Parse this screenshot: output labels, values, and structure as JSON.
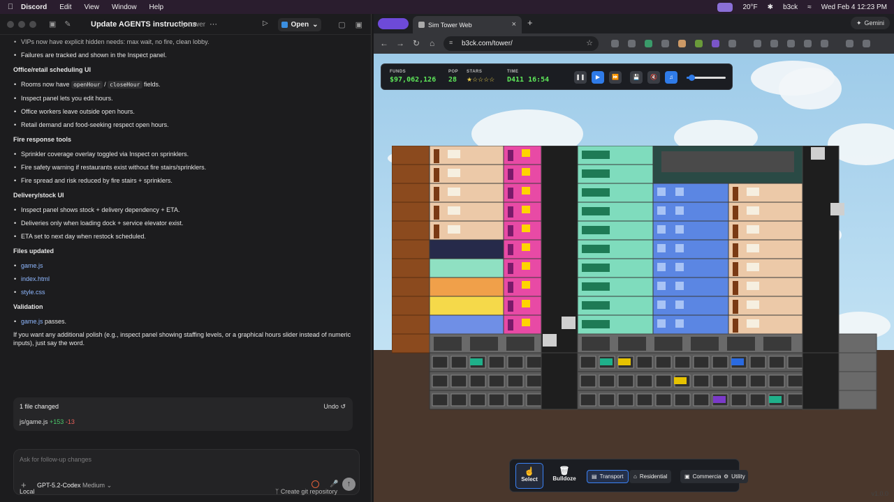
{
  "menubar": {
    "app": "Discord",
    "items": [
      "Edit",
      "View",
      "Window",
      "Help"
    ],
    "weather": "20°F",
    "user": "b3ck",
    "clock": "Wed Feb 4  12:23 PM"
  },
  "codex": {
    "title": "Update AGENTS instructions",
    "project": "my-tower",
    "open_label": "Open",
    "content": {
      "vip_line": "VIPs now have explicit hidden needs: max wait, no fire, clean lobby.",
      "failures_line": "Failures are tracked and shown in the Inspect panel.",
      "s1_title": "Office/retail scheduling UI",
      "s1_b1_pre": "Rooms now have",
      "s1_b1_code1": "openHour",
      "s1_b1_sep": "/",
      "s1_b1_code2": "closeHour",
      "s1_b1_post": "fields.",
      "s1_b2": "Inspect panel lets you edit hours.",
      "s1_b3": "Office workers leave outside open hours.",
      "s1_b4": "Retail demand and food-seeking respect open hours.",
      "s2_title": "Fire response tools",
      "s2_b1": "Sprinkler coverage overlay toggled via Inspect on sprinklers.",
      "s2_b2": "Fire safety warning if restaurants exist without fire stairs/sprinklers.",
      "s2_b3": "Fire spread and risk reduced by fire stairs + sprinklers.",
      "s3_title": "Delivery/stock UI",
      "s3_b1": "Inspect panel shows stock + delivery dependency + ETA.",
      "s3_b2": "Deliveries only when loading dock + service elevator exist.",
      "s3_b3": "ETA set to next day when restock scheduled.",
      "s4_title": "Files updated",
      "s4_f1": "game.js",
      "s4_f2": "index.html",
      "s4_f3": "style.css",
      "s5_title": "Validation",
      "s5_b1_file": "game.js",
      "s5_b1_post": "passes.",
      "closing": "If you want any additional polish (e.g., inspect panel showing staffing levels, or a graphical hours slider instead of numeric inputs), just say the word."
    },
    "changes": {
      "header": "1 file changed",
      "undo": "Undo",
      "file": "js/game.js",
      "added": "+153",
      "removed": "-13"
    },
    "composer": {
      "placeholder": "Ask for follow-up changes",
      "model": "GPT-5.2-Codex",
      "effort": "Medium"
    },
    "footer": {
      "location": "Local",
      "git": "Create git repository"
    }
  },
  "browser": {
    "tab_title": "Sim Tower Web",
    "url": "b3ck.com/tower/",
    "gemini": "Gemini"
  },
  "game": {
    "hud": {
      "funds_label": "FUNDS",
      "funds": "$97,062,126",
      "pop_label": "POP",
      "pop": "28",
      "stars_label": "STARS",
      "stars": "★☆☆☆☆",
      "time_label": "TIME",
      "time": "D411 16:54",
      "volume": 0.12
    },
    "palette": {
      "select": "Select",
      "bulldoze": "Bulldoze",
      "categories": [
        "Transport",
        "Residential",
        "Commercial",
        "Utility"
      ]
    },
    "version": "v1.0.0"
  }
}
